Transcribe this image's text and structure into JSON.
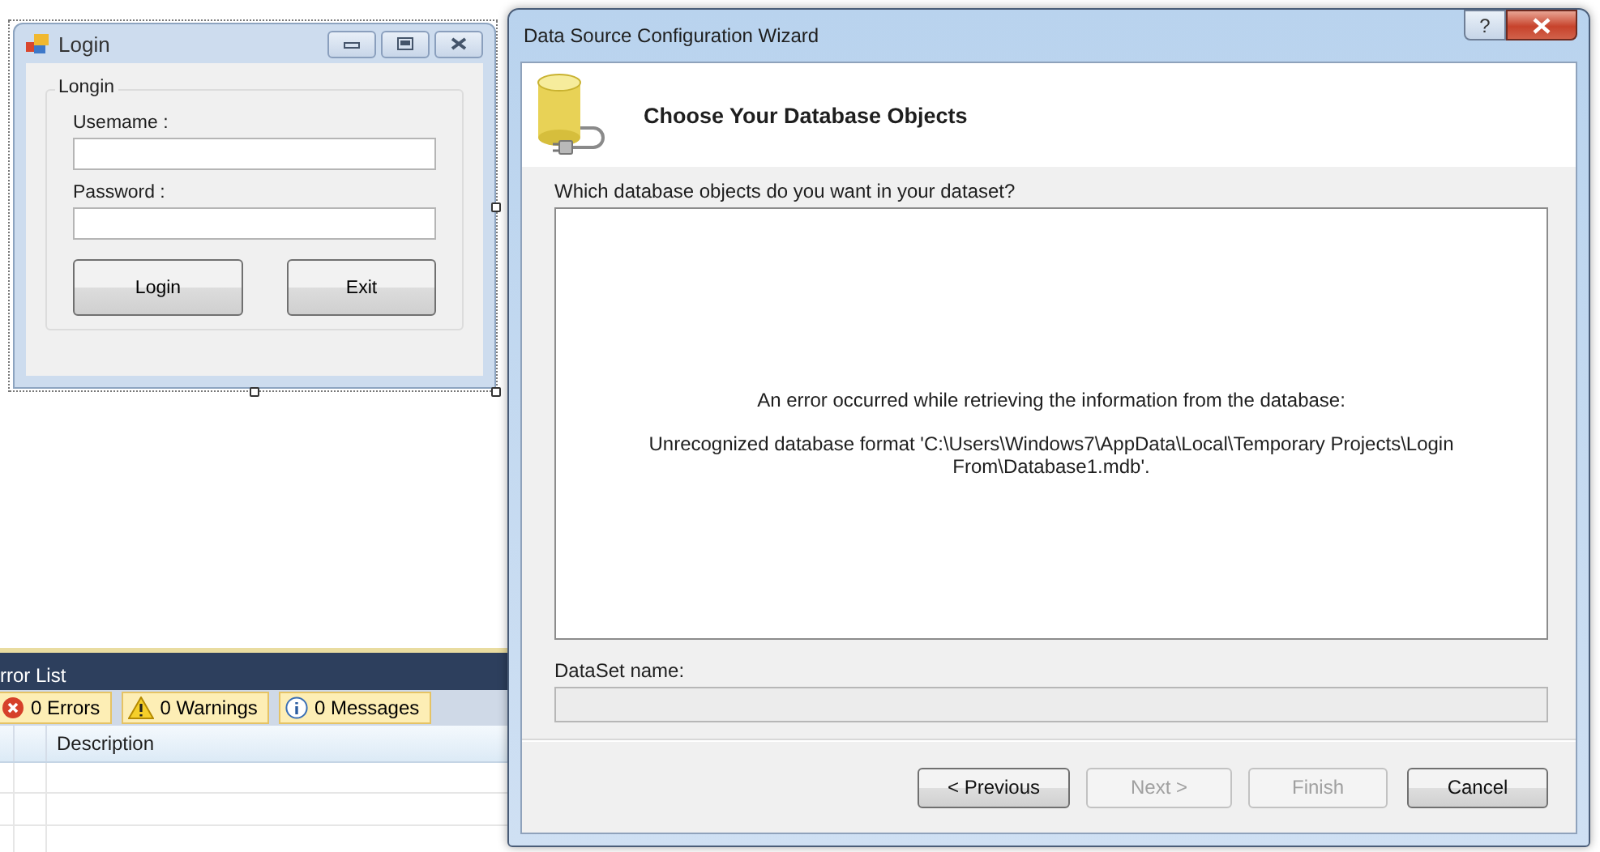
{
  "login_form": {
    "title": "Login",
    "group": "Longin",
    "fields": [
      {
        "label": "Usemame :"
      },
      {
        "label": "Password :"
      }
    ],
    "buttons": [
      "Login",
      "Exit"
    ]
  },
  "error_list": {
    "title": "rror List",
    "filters": [
      {
        "kind": "error",
        "label": "0 Errors"
      },
      {
        "kind": "warning",
        "label": "0 Warnings"
      },
      {
        "kind": "info",
        "label": "0 Messages"
      }
    ],
    "columns": [
      "Description"
    ]
  },
  "wizard": {
    "title": "Data Source Configuration Wizard",
    "help": "?",
    "heading": "Choose Your Database Objects",
    "prompt": "Which database objects do you want in your dataset?",
    "error_lines": [
      "An error occurred while retrieving the information from the database:",
      "Unrecognized database format 'C:\\Users\\Windows7\\AppData\\Local\\Temporary Projects\\Login From\\Database1.mdb'."
    ],
    "dataset_label": "DataSet name:",
    "buttons": [
      {
        "label": "< Previous",
        "disabled": false
      },
      {
        "label": "Next >",
        "disabled": true
      },
      {
        "label": "Finish",
        "disabled": true
      },
      {
        "label": "Cancel",
        "disabled": false
      }
    ]
  }
}
